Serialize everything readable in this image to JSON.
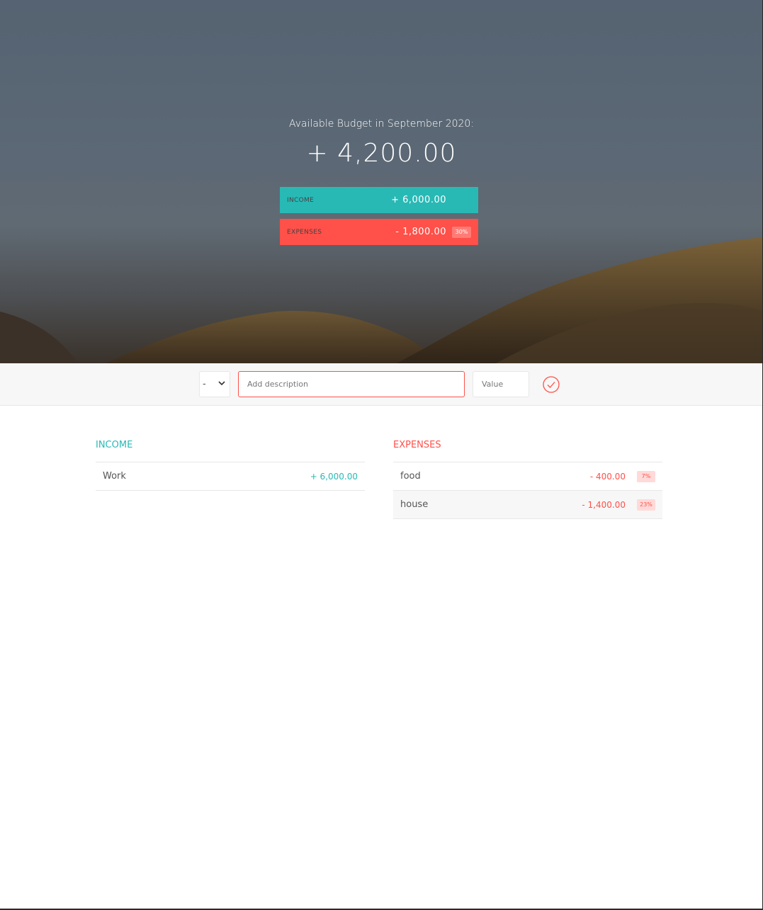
{
  "budget": {
    "title": "Available Budget in September 2020:",
    "value": "+ 4,200.00"
  },
  "summary": {
    "income": {
      "label": "Income",
      "value": "+ 6,000.00"
    },
    "expenses": {
      "label": "Expenses",
      "value": "- 1,800.00",
      "percentage": "30%"
    }
  },
  "add": {
    "type_selected": "-",
    "description_placeholder": "Add description",
    "value_placeholder": "Value",
    "submit_icon": "checkmark-circle-icon"
  },
  "income_list": {
    "title": "Income",
    "items": [
      {
        "description": "Work",
        "value": "+ 6,000.00"
      }
    ]
  },
  "expenses_list": {
    "title": "Expenses",
    "items": [
      {
        "description": "food",
        "value": "- 400.00",
        "percentage": "7%"
      },
      {
        "description": "house",
        "value": "- 1,400.00",
        "percentage": "23%"
      }
    ]
  },
  "colors": {
    "income": "#28b9b5",
    "expenses": "#ff5049"
  }
}
